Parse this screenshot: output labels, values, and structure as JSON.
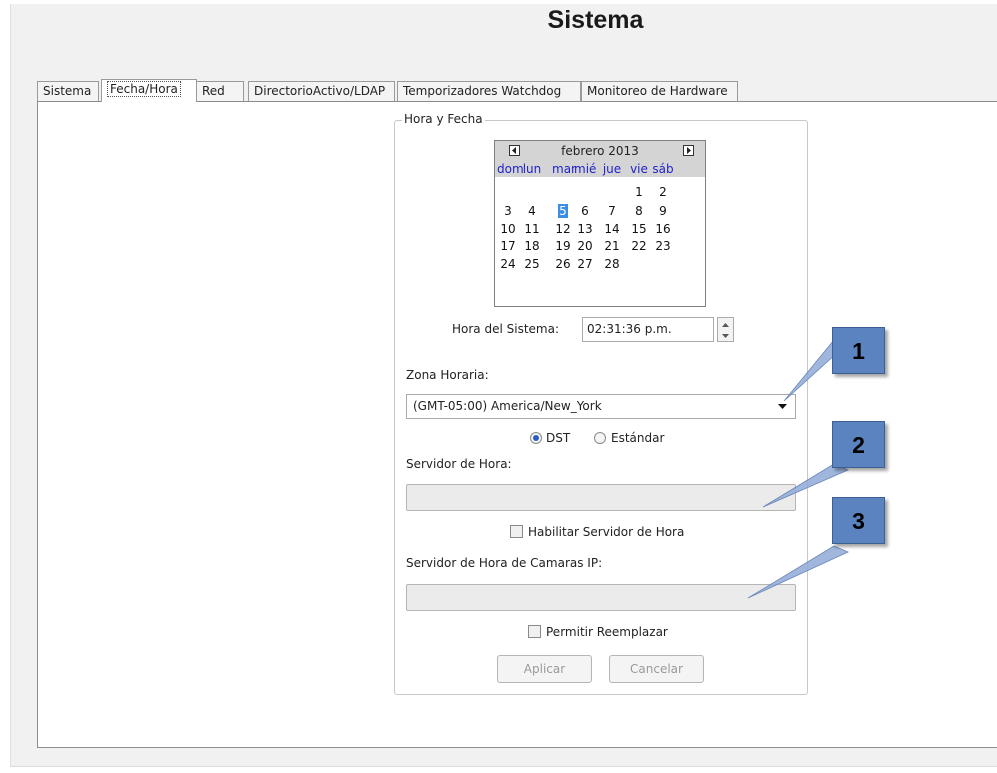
{
  "title": "Sistema",
  "tabs": [
    {
      "label": "Sistema",
      "active": false
    },
    {
      "label": "Fecha/Hora",
      "active": true
    },
    {
      "label": "Red",
      "active": false
    },
    {
      "label": "DirectorioActivo/LDAP",
      "active": false
    },
    {
      "label": "Temporizadores Watchdog",
      "active": false
    },
    {
      "label": "Monitoreo de Hardware",
      "active": false
    }
  ],
  "group": {
    "legend": "Hora y Fecha"
  },
  "calendar": {
    "month_label": "febrero 2013",
    "days_of_week": [
      "dom",
      "lun",
      "mar",
      "mié",
      "jue",
      "vie",
      "sáb"
    ],
    "weeks": [
      [
        "",
        "",
        "",
        "",
        "",
        "1",
        "2"
      ],
      [
        "3",
        "4",
        "5",
        "6",
        "7",
        "8",
        "9"
      ],
      [
        "10",
        "11",
        "12",
        "13",
        "14",
        "15",
        "16"
      ],
      [
        "17",
        "18",
        "19",
        "20",
        "21",
        "22",
        "23"
      ],
      [
        "24",
        "25",
        "26",
        "27",
        "28",
        "",
        ""
      ]
    ],
    "selected_day": "5"
  },
  "system_time": {
    "label": "Hora del Sistema:",
    "value": "02:31:36 p.m."
  },
  "timezone": {
    "label": "Zona Horaria:",
    "value": "(GMT-05:00) America/New_York"
  },
  "dst": {
    "dst_label": "DST",
    "standard_label": "Estándar",
    "selected": "DST"
  },
  "time_server": {
    "label": "Servidor de Hora:",
    "value": "",
    "enable_label": "Habilitar Servidor de Hora",
    "enabled": false
  },
  "ip_camera_server": {
    "label": "Servidor de Hora de Camaras IP:",
    "value": "",
    "override_label": "Permitir Reemplazar",
    "override": false
  },
  "buttons": {
    "apply": "Aplicar",
    "cancel": "Cancelar"
  },
  "callouts": [
    "1",
    "2",
    "3"
  ],
  "colors": {
    "callout_fill": "#5b83c0",
    "selected_day": "#3a8ee6",
    "dow_text": "#2222cc"
  }
}
